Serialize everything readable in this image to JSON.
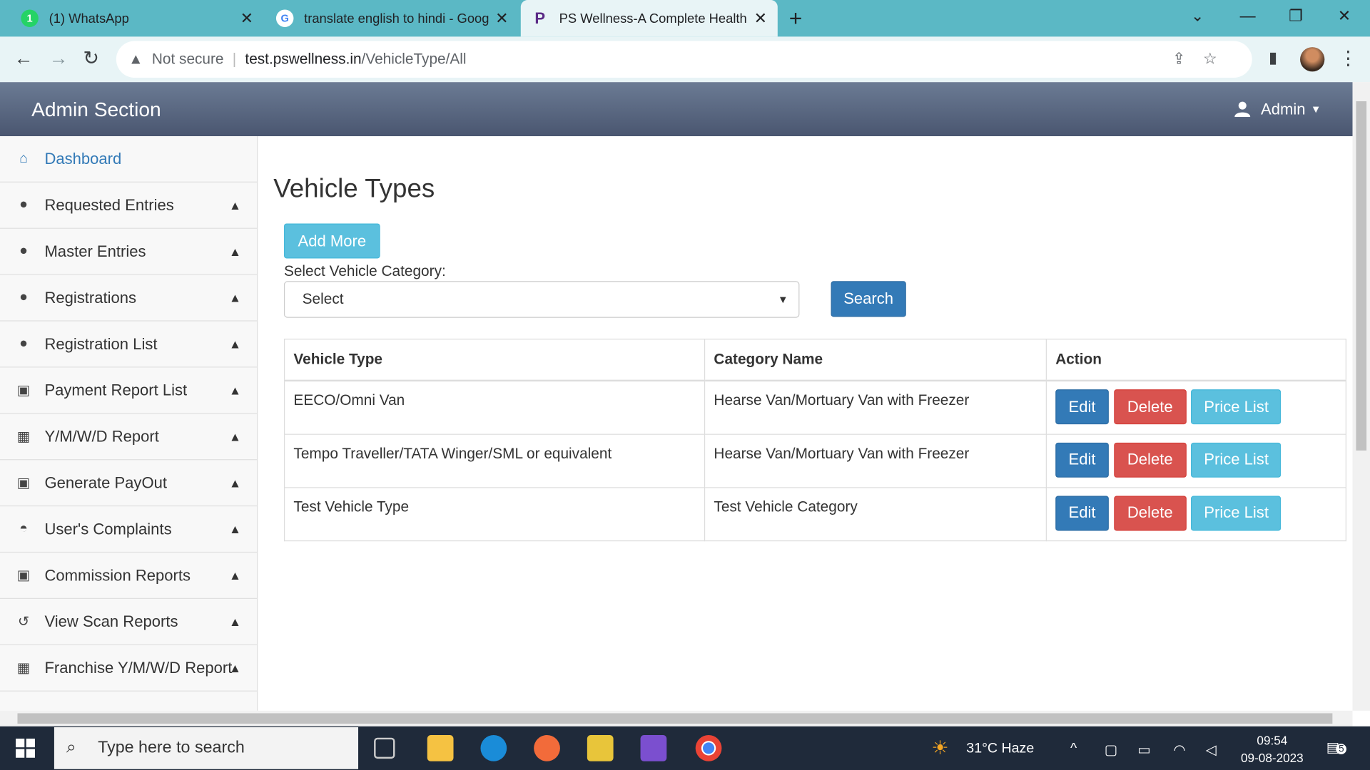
{
  "browser": {
    "tabs": [
      {
        "title": "(1) WhatsApp",
        "icon": "whatsapp-icon",
        "color": "#25d366"
      },
      {
        "title": "translate english to hindi - Goog",
        "icon": "google-icon",
        "color": "#4285f4"
      },
      {
        "title": "PS Wellness-A Complete Health C",
        "icon": "pswellness-icon",
        "color": "#5b2a86"
      }
    ],
    "address": {
      "not_secure": "Not secure",
      "host": "test.pswellness.in",
      "path": "/VehicleType/All"
    }
  },
  "header": {
    "brand": "Admin Section",
    "user": "Admin"
  },
  "sidebar": {
    "items": [
      {
        "label": "Dashboard",
        "icon": "home-icon"
      },
      {
        "label": "Requested Entries",
        "icon": "user-icon"
      },
      {
        "label": "Master Entries",
        "icon": "user-icon"
      },
      {
        "label": "Registrations",
        "icon": "user-icon"
      },
      {
        "label": "Registration List",
        "icon": "user-icon"
      },
      {
        "label": "Payment Report List",
        "icon": "money-icon"
      },
      {
        "label": "Y/M/W/D Report",
        "icon": "calendar-icon"
      },
      {
        "label": "Generate PayOut",
        "icon": "money-icon"
      },
      {
        "label": "User's Complaints",
        "icon": "comments-icon"
      },
      {
        "label": "Commission Reports",
        "icon": "money-icon"
      },
      {
        "label": "View Scan Reports",
        "icon": "history-icon"
      },
      {
        "label": "Franchise Y/M/W/D Report",
        "icon": "calendar-icon"
      }
    ]
  },
  "main": {
    "title": "Vehicle Types",
    "add_more": "Add More",
    "select_label": "Select Vehicle Category:",
    "select_value": "Select",
    "search": "Search",
    "table": {
      "headers": [
        "Vehicle Type",
        "Category Name",
        "Action"
      ],
      "rows": [
        {
          "type": "EECO/Omni Van",
          "category": "Hearse Van/Mortuary Van with Freezer"
        },
        {
          "type": "Tempo Traveller/TATA Winger/SML or equivalent",
          "category": "Hearse Van/Mortuary Van with Freezer"
        },
        {
          "type": "Test Vehicle Type",
          "category": "Test Vehicle Category"
        }
      ],
      "actions": {
        "edit": "Edit",
        "delete": "Delete",
        "price": "Price List"
      }
    }
  },
  "taskbar": {
    "search_placeholder": "Type here to search",
    "weather": "31°C  Haze",
    "time": "09:54",
    "date": "09-08-2023",
    "notifications": "5"
  }
}
